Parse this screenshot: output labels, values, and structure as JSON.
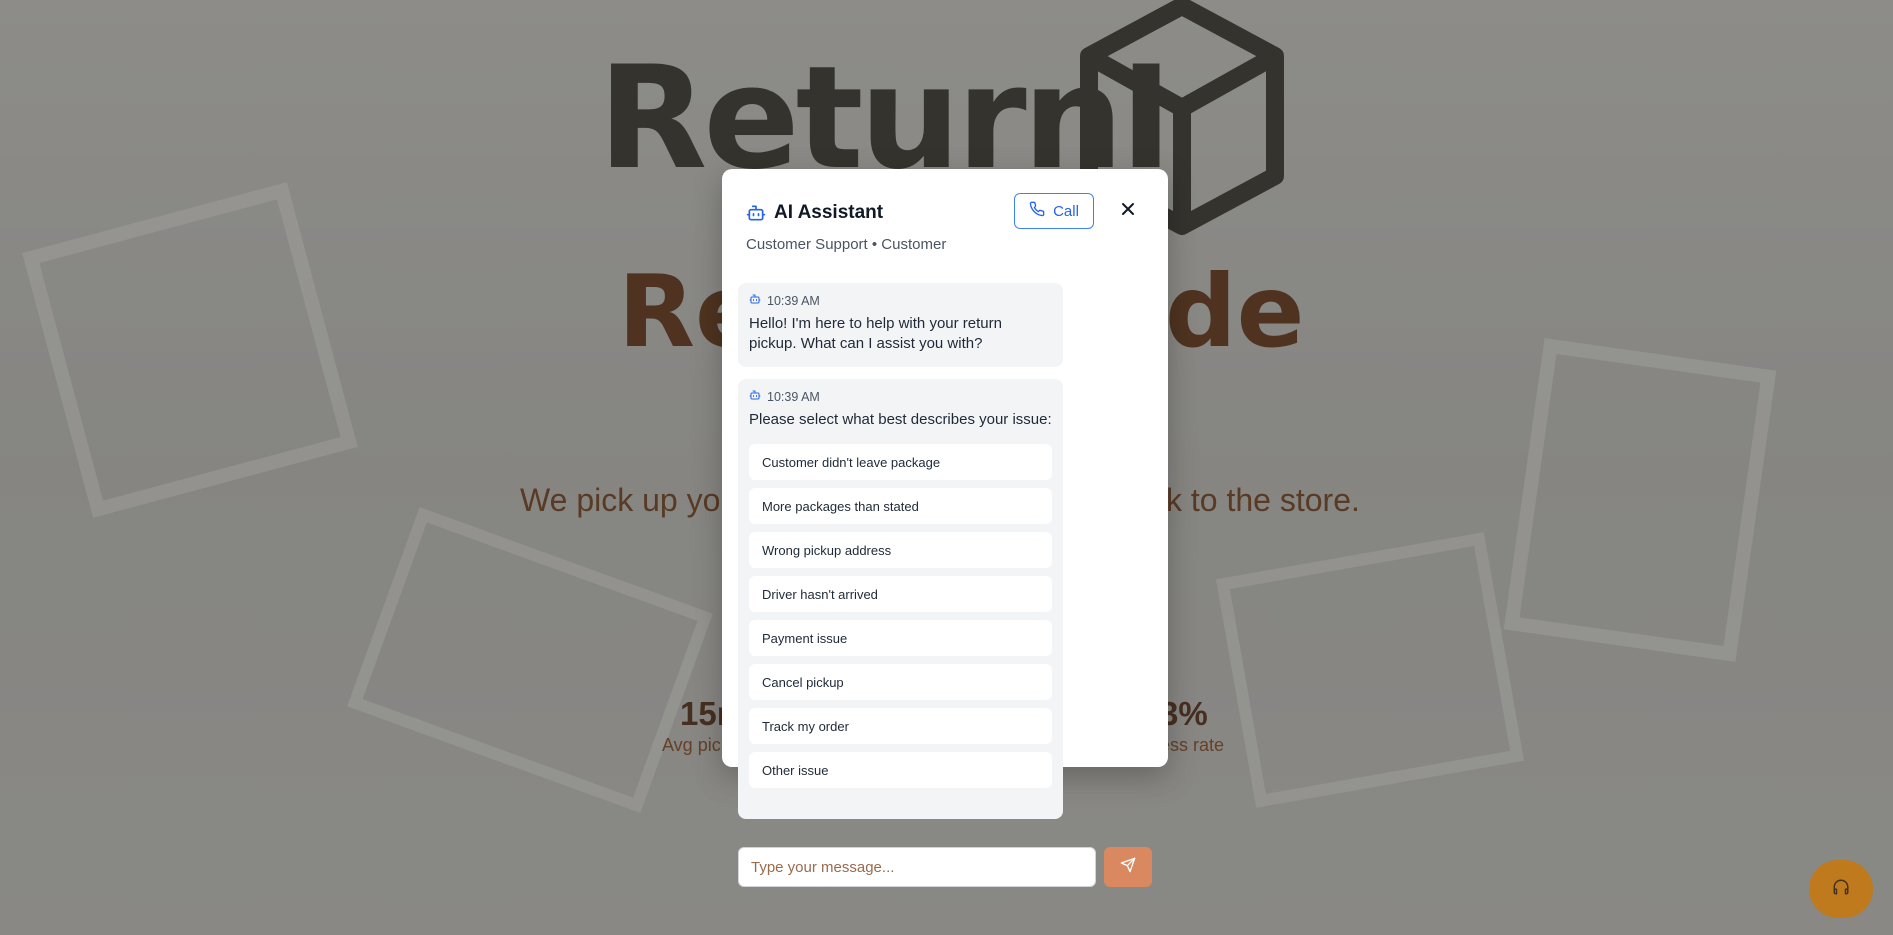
{
  "background": {
    "brand_text": "ReturnI",
    "hero_title_left": "Re",
    "hero_title_right": "de",
    "hero_subtitle_left": "We pick up yo",
    "hero_subtitle_right": "ck to the store.",
    "stat_left_value": "15r",
    "stat_left_label": "Avg pick",
    "stat_right_value": "3%",
    "stat_right_label": "ess rate"
  },
  "chat": {
    "title": "AI Assistant",
    "subtitle": "Customer Support • Customer",
    "call_label": "Call",
    "messages": [
      {
        "time": "10:39 AM",
        "text": "Hello! I'm here to help with your return pickup. What can I assist you with?"
      },
      {
        "time": "10:39 AM",
        "text": "Please select what best describes your issue:",
        "options": [
          "Customer didn't leave package",
          "More packages than stated",
          "Wrong pickup address",
          "Driver hasn't arrived",
          "Payment issue",
          "Cancel pickup",
          "Track my order",
          "Other issue"
        ]
      }
    ],
    "input_placeholder": "Type your message..."
  },
  "colors": {
    "accent_blue": "#2563eb",
    "send_button": "#d9885f",
    "support_fab": "#c8780a"
  },
  "icons": {
    "header": "bot-icon",
    "call": "phone-icon",
    "close": "close-icon",
    "send": "send-icon",
    "fab": "headset-icon"
  }
}
